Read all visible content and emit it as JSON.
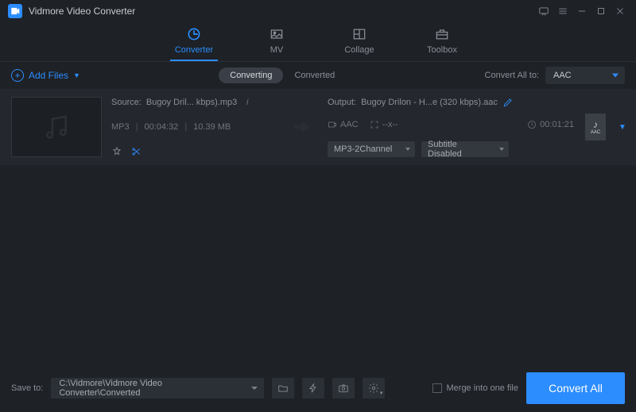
{
  "app": {
    "title": "Vidmore Video Converter"
  },
  "nav": {
    "converter": "Converter",
    "mv": "MV",
    "collage": "Collage",
    "toolbox": "Toolbox"
  },
  "toolbar": {
    "add_files": "Add Files",
    "converting": "Converting",
    "converted": "Converted",
    "convert_all_to": "Convert All to:",
    "convert_all_value": "AAC"
  },
  "item": {
    "source_label": "Source:",
    "source_name": "Bugoy Dril... kbps).mp3",
    "format": "MP3",
    "duration": "00:04:32",
    "size": "10.39 MB",
    "output_label": "Output:",
    "output_name": "Bugoy Drilon - H...e (320 kbps).aac",
    "out_format": "AAC",
    "resolution": "--x--",
    "out_duration": "00:01:21",
    "audio_channel": "MP3-2Channel",
    "subtitle": "Subtitle Disabled",
    "thumb_label": "AAC"
  },
  "footer": {
    "save_to": "Save to:",
    "path": "C:\\Vidmore\\Vidmore Video Converter\\Converted",
    "merge": "Merge into one file",
    "convert_all": "Convert All"
  }
}
